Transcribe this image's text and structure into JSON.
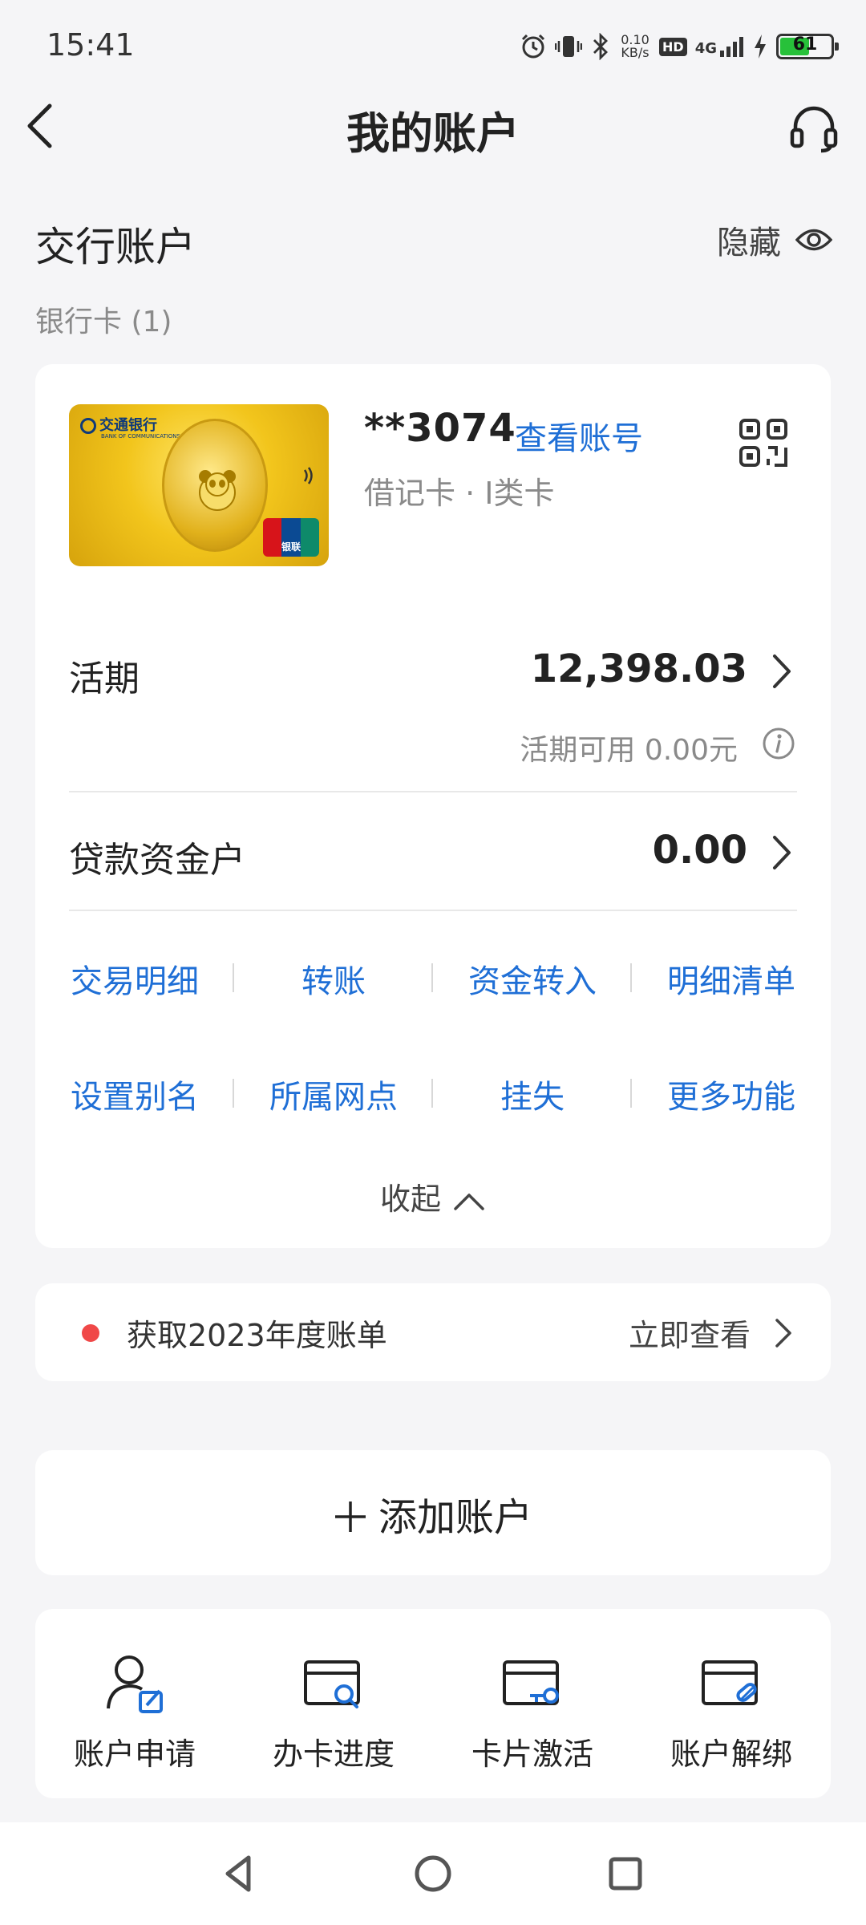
{
  "status_bar": {
    "time": "15:41",
    "net_speed_value": "0.10",
    "net_speed_unit": "KB/s",
    "hd": "HD",
    "network": "4G",
    "battery": "61",
    "battery_level": 0.61
  },
  "header": {
    "title": "我的账户"
  },
  "section": {
    "title": "交行账户",
    "hide_label": "隐藏",
    "card_count_label": "银行卡 (1)"
  },
  "card": {
    "bank_name": "交通银行",
    "card_face_sub": "BANK OF COMMUNICATIONS",
    "unionpay_label": "银联",
    "number": "**3074",
    "view_number_link": "查看账号",
    "type": "借记卡 · I类卡"
  },
  "demand": {
    "label": "活期",
    "amount": "12,398.03",
    "available": "活期可用 0.00元"
  },
  "loan": {
    "label": "贷款资金户",
    "amount": "0.00"
  },
  "actions": [
    [
      "交易明细",
      "转账",
      "资金转入",
      "明细清单"
    ],
    [
      "设置别名",
      "所属网点",
      "挂失",
      "更多功能"
    ]
  ],
  "collapse_label": "收起",
  "annual_bill": {
    "text": "获取2023年度账单",
    "link": "立即查看"
  },
  "add_account_label": "添加账户",
  "quick_services": [
    {
      "label": "账户申请",
      "icon": "account-apply-icon"
    },
    {
      "label": "办卡进度",
      "icon": "card-progress-icon"
    },
    {
      "label": "卡片激活",
      "icon": "card-activate-icon"
    },
    {
      "label": "账户解绑",
      "icon": "account-unbind-icon"
    }
  ],
  "colors": {
    "accent": "#1f6fd6",
    "background": "#f5f5f7",
    "alert_dot": "#f04848",
    "battery": "#27c13a"
  }
}
